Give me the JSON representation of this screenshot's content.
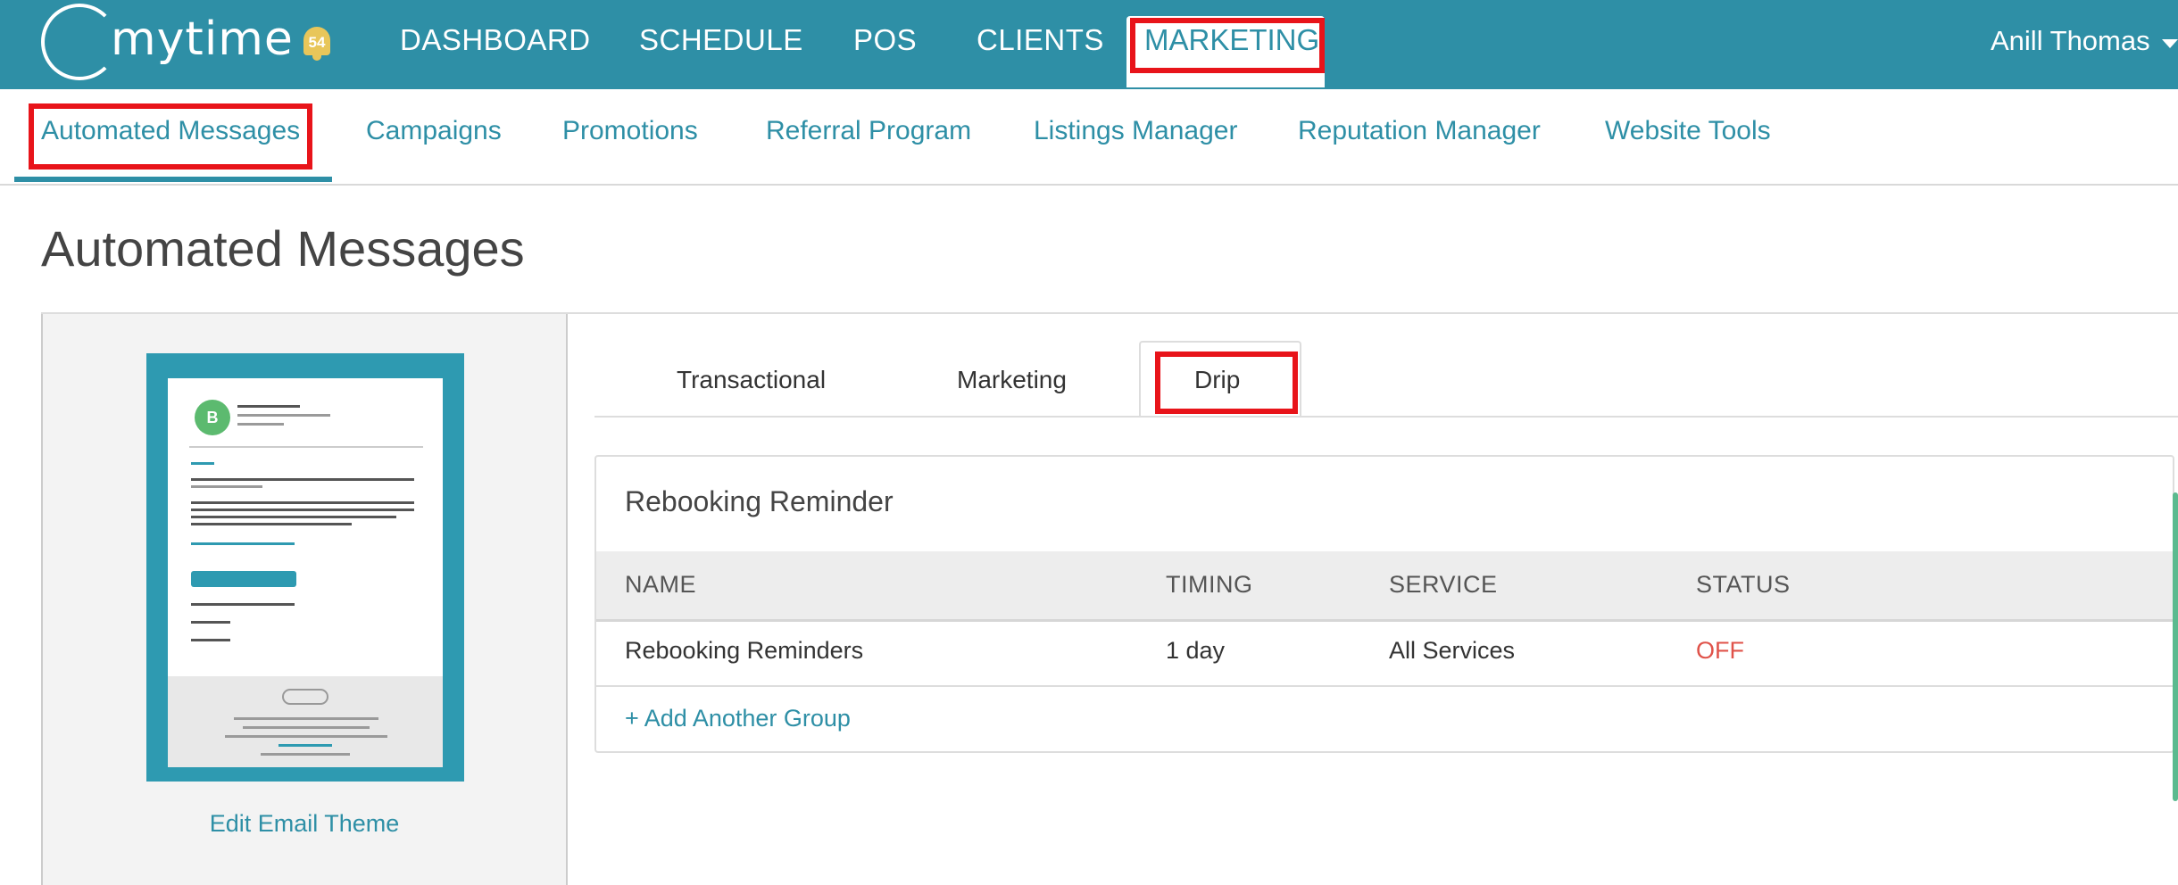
{
  "brand": {
    "logo_text": "mytime"
  },
  "notifications": {
    "count": "54"
  },
  "main_nav": [
    {
      "label": "DASHBOARD"
    },
    {
      "label": "SCHEDULE"
    },
    {
      "label": "POS"
    },
    {
      "label": "CLIENTS"
    },
    {
      "label": "MARKETING",
      "active": true
    }
  ],
  "user": {
    "name": "Anill Thomas"
  },
  "sub_nav": [
    {
      "label": "Automated Messages",
      "active": true
    },
    {
      "label": "Campaigns"
    },
    {
      "label": "Promotions"
    },
    {
      "label": "Referral Program"
    },
    {
      "label": "Listings Manager"
    },
    {
      "label": "Reputation Manager"
    },
    {
      "label": "Website Tools"
    }
  ],
  "page": {
    "title": "Automated Messages"
  },
  "theme_panel": {
    "edit_label": "Edit Email Theme"
  },
  "tabs": [
    {
      "label": "Transactional"
    },
    {
      "label": "Marketing"
    },
    {
      "label": "Drip",
      "active": true
    }
  ],
  "card": {
    "title": "Rebooking Reminder",
    "columns": [
      "NAME",
      "TIMING",
      "SERVICE",
      "STATUS"
    ],
    "rows": [
      {
        "name": "Rebooking Reminders",
        "timing": "1 day",
        "service": "All Services",
        "status": "OFF"
      }
    ],
    "add_group_label": "+ Add Another Group"
  },
  "colors": {
    "primary": "#2e8fa6",
    "status_off": "#e0534a",
    "annotation": "#e8141a"
  }
}
